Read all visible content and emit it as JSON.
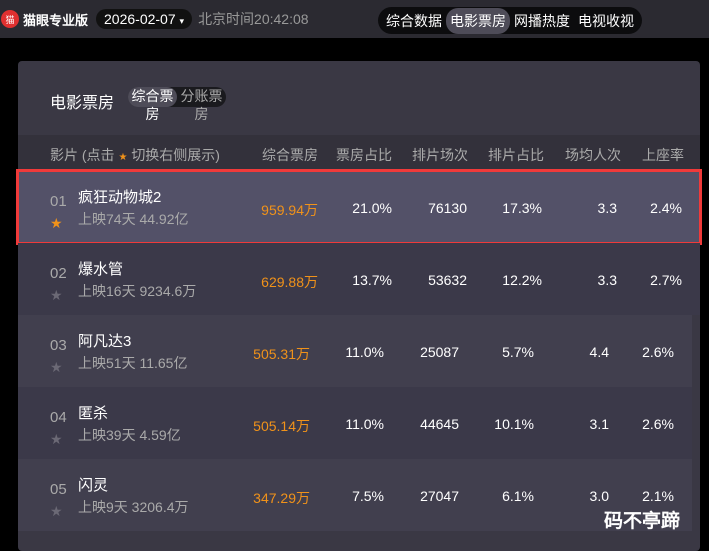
{
  "topbar": {
    "logo": "猫",
    "brand": "猫眼专业版",
    "date": "2026-02-07",
    "date_caret": "▾",
    "clock": "北京时间20:42:08",
    "tabs": [
      {
        "label": "综合数据"
      },
      {
        "label": "电影票房",
        "active": true
      },
      {
        "label": "网播热度"
      },
      {
        "label": "电视收视"
      }
    ]
  },
  "panel": {
    "title": "电影票房",
    "subtabs": [
      "综合票房",
      "分账票房"
    ]
  },
  "table": {
    "headers": {
      "film": "影片 (点击",
      "film_star": "★",
      "film_tail": "切换右侧展示)",
      "gross": "综合票房",
      "share": "票房占比",
      "shows": "排片场次",
      "show_share": "排片占比",
      "avg": "场均人次",
      "seat": "上座率"
    },
    "rows": [
      {
        "rank": "01",
        "name": "疯狂动物城2",
        "sub": "上映74天  44.92亿",
        "gross": "959.94万",
        "share": "21.0%",
        "shows": "76130",
        "show_share": "17.3%",
        "avg": "3.3",
        "seat": "2.4%",
        "starred": true
      },
      {
        "rank": "02",
        "name": "爆水管",
        "sub": "上映16天  9234.6万",
        "gross": "629.88万",
        "share": "13.7%",
        "shows": "53632",
        "show_share": "12.2%",
        "avg": "3.3",
        "seat": "2.7%"
      },
      {
        "rank": "03",
        "name": "阿凡达3",
        "sub": "上映51天  11.65亿",
        "gross": "505.31万",
        "share": "11.0%",
        "shows": "25087",
        "show_share": "5.7%",
        "avg": "4.4",
        "seat": "2.6%"
      },
      {
        "rank": "04",
        "name": "匿杀",
        "sub": "上映39天  4.59亿",
        "gross": "505.14万",
        "share": "11.0%",
        "shows": "44645",
        "show_share": "10.1%",
        "avg": "3.1",
        "seat": "2.6%"
      },
      {
        "rank": "05",
        "name": "闪灵",
        "sub": "上映9天  3206.4万",
        "gross": "347.29万",
        "share": "7.5%",
        "shows": "27047",
        "show_share": "6.1%",
        "avg": "3.0",
        "seat": "2.1%"
      }
    ]
  },
  "watermark": "码不亭蹄"
}
